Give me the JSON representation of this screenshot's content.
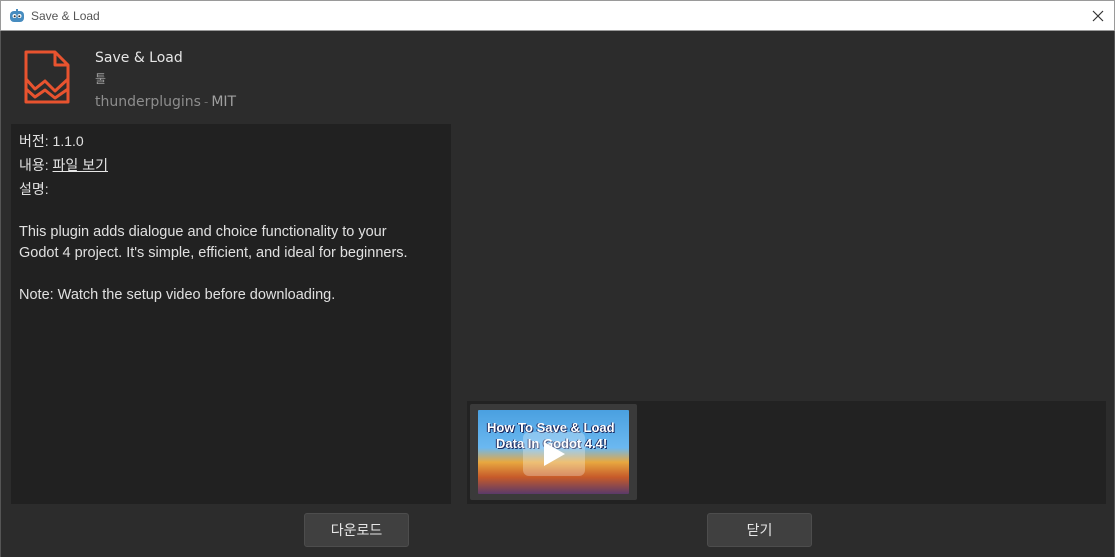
{
  "window": {
    "title": "Save & Load",
    "icon": "godot-icon",
    "close_icon": "close-icon"
  },
  "plugin": {
    "name": "Save & Load",
    "category": "툴",
    "author": "thunderplugins",
    "separator": "-",
    "license": "MIT",
    "icon": "document-zigzag-icon",
    "icon_color": "#e8532f"
  },
  "details": {
    "version_label": "버전:",
    "version_value": "1.1.0",
    "contents_label": "내용:",
    "contents_link": "파일 보기",
    "description_label": "설명:",
    "description": "This plugin adds dialogue and choice functionality to your\nGodot 4 project. It's simple, efficient, and ideal for beginners.\n\nNote: Watch the setup video before downloading."
  },
  "preview": {
    "thumb_line1": "How To Save & Load",
    "thumb_line2": "Data In Godot 4.4!",
    "play_icon": "play-icon"
  },
  "buttons": {
    "download": "다운로드",
    "close": "닫기"
  }
}
